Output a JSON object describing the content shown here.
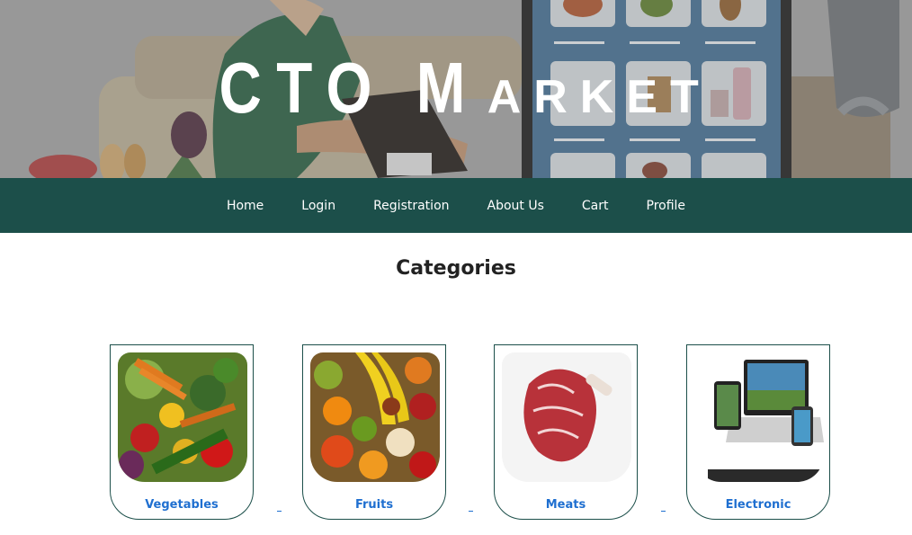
{
  "brand": {
    "first": "CTO",
    "second_initial": "M",
    "second_rest": "ARKET"
  },
  "nav": {
    "items": [
      "Home",
      "Login",
      "Registration",
      "About Us",
      "Cart",
      "Profile"
    ]
  },
  "categories": {
    "title": "Categories",
    "items": [
      {
        "label": "Vegetables",
        "image": "vegetables-photo"
      },
      {
        "label": "Fruits",
        "image": "fruits-photo"
      },
      {
        "label": "Meats",
        "image": "meat-photo"
      },
      {
        "label": "Electronic",
        "image": "electronics-photo"
      }
    ]
  },
  "colors": {
    "nav_bg": "#1c4f4a",
    "link": "#1f6fd0",
    "heading": "#222222"
  }
}
